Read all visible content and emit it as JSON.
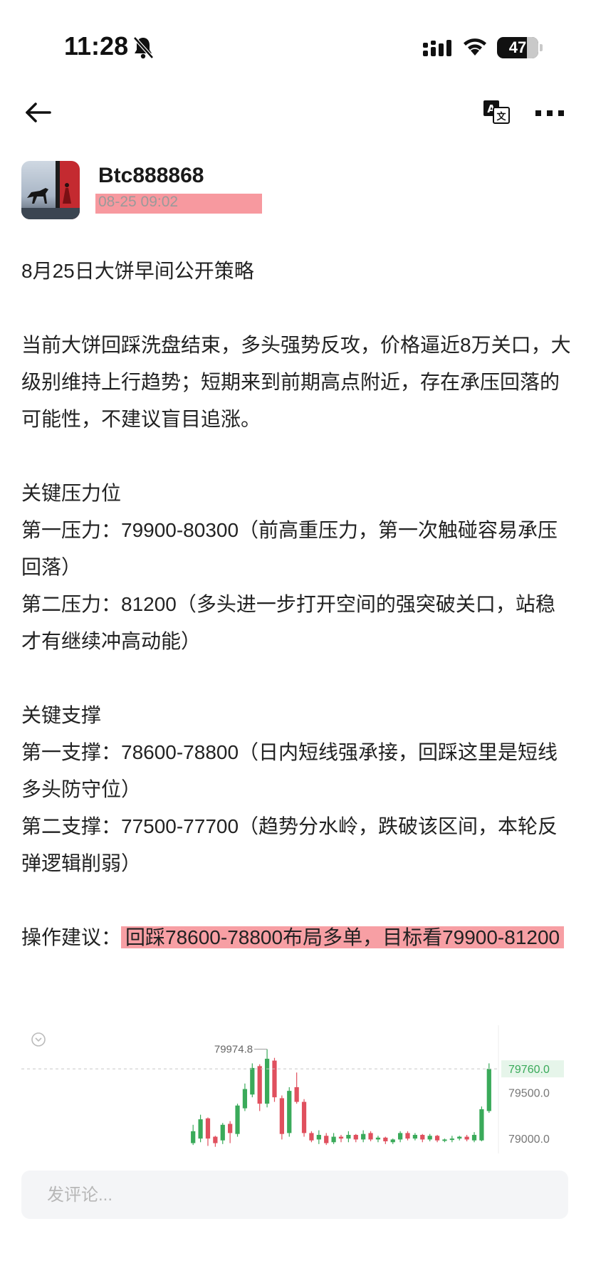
{
  "status_bar": {
    "time": "11:28",
    "battery": "47"
  },
  "post": {
    "author": "Btc888868",
    "time": "08-25 09:02",
    "title": "8月25日大饼早间公开策略",
    "intro": "当前大饼回踩洗盘结束，多头强势反攻，价格逼近8万关口，大级别维持上行趋势；短期来到前期高点附近，存在承压回落的可能性，不建议盲目追涨。",
    "resistance_heading": "关键压力位",
    "resistance_1": "第一压力：79900-80300（前高重压力，第一次触碰容易承压回落）",
    "resistance_2": "第二压力：81200（多头进一步打开空间的强突破关口，站稳才有继续冲高动能）",
    "support_heading": "关键支撑",
    "support_1": "第一支撑：78600-78800（日内短线强承接，回踩这里是短线多头防守位）",
    "support_2": "第二支撑：77500-77700（趋势分水岭，跌破该区间，本轮反弹逻辑削弱）",
    "advice_label": "操作建议：",
    "advice_text": "回踩78600-78800布局多单，目标看79900-81200"
  },
  "chart_data": {
    "type": "candlestick",
    "high_label": "79974.8",
    "price_labels": [
      "79760.0",
      "79500.0",
      "79000.0"
    ],
    "current_price": 79760.0,
    "ylim": [
      78900,
      80080
    ],
    "colors": {
      "up": "#3aaa5a",
      "down": "#e0505e",
      "current": "#3aaa5a"
    },
    "candles": [
      {
        "o": 78950,
        "c": 79080,
        "h": 79150,
        "l": 78930
      },
      {
        "o": 79000,
        "c": 79210,
        "h": 79260,
        "l": 78960
      },
      {
        "o": 79220,
        "c": 79000,
        "h": 79230,
        "l": 78920
      },
      {
        "o": 79020,
        "c": 78950,
        "h": 79030,
        "l": 78910
      },
      {
        "o": 78980,
        "c": 79150,
        "h": 79170,
        "l": 78940
      },
      {
        "o": 79160,
        "c": 79060,
        "h": 79190,
        "l": 78950
      },
      {
        "o": 79050,
        "c": 79360,
        "h": 79380,
        "l": 79020
      },
      {
        "o": 79330,
        "c": 79540,
        "h": 79600,
        "l": 79300
      },
      {
        "o": 79480,
        "c": 79770,
        "h": 79820,
        "l": 79450
      },
      {
        "o": 79790,
        "c": 79380,
        "h": 79810,
        "l": 79300
      },
      {
        "o": 79380,
        "c": 79870,
        "h": 79974,
        "l": 79340
      },
      {
        "o": 79850,
        "c": 79450,
        "h": 79880,
        "l": 79400
      },
      {
        "o": 79440,
        "c": 79050,
        "h": 79470,
        "l": 78990
      },
      {
        "o": 79060,
        "c": 79520,
        "h": 79560,
        "l": 79020
      },
      {
        "o": 79560,
        "c": 79400,
        "h": 79720,
        "l": 79380
      },
      {
        "o": 79400,
        "c": 79060,
        "h": 79430,
        "l": 79020
      },
      {
        "o": 79060,
        "c": 78980,
        "h": 79080,
        "l": 78960
      },
      {
        "o": 78990,
        "c": 79040,
        "h": 79090,
        "l": 78940
      },
      {
        "o": 79030,
        "c": 78950,
        "h": 79060,
        "l": 78930
      },
      {
        "o": 78960,
        "c": 79020,
        "h": 79060,
        "l": 78940
      },
      {
        "o": 79020,
        "c": 79000,
        "h": 79040,
        "l": 78960
      },
      {
        "o": 79000,
        "c": 79040,
        "h": 79080,
        "l": 78960
      },
      {
        "o": 79040,
        "c": 78990,
        "h": 79050,
        "l": 78960
      },
      {
        "o": 78990,
        "c": 79050,
        "h": 79090,
        "l": 78960
      },
      {
        "o": 79060,
        "c": 78990,
        "h": 79080,
        "l": 78970
      },
      {
        "o": 78990,
        "c": 79010,
        "h": 79030,
        "l": 78960
      },
      {
        "o": 79010,
        "c": 78970,
        "h": 79020,
        "l": 78940
      },
      {
        "o": 78960,
        "c": 78990,
        "h": 79000,
        "l": 78940
      },
      {
        "o": 78990,
        "c": 79060,
        "h": 79080,
        "l": 78960
      },
      {
        "o": 79060,
        "c": 79000,
        "h": 79080,
        "l": 78980
      },
      {
        "o": 79000,
        "c": 79040,
        "h": 79060,
        "l": 78980
      },
      {
        "o": 79040,
        "c": 78990,
        "h": 79050,
        "l": 78960
      },
      {
        "o": 78990,
        "c": 79030,
        "h": 79050,
        "l": 78970
      },
      {
        "o": 79030,
        "c": 78980,
        "h": 79040,
        "l": 78960
      },
      {
        "o": 78980,
        "c": 78990,
        "h": 79000,
        "l": 78960
      },
      {
        "o": 78990,
        "c": 79000,
        "h": 79030,
        "l": 78960
      },
      {
        "o": 79000,
        "c": 79020,
        "h": 79030,
        "l": 78980
      },
      {
        "o": 79020,
        "c": 78990,
        "h": 79040,
        "l": 78970
      },
      {
        "o": 78980,
        "c": 79040,
        "h": 79070,
        "l": 78960
      },
      {
        "o": 78980,
        "c": 79320,
        "h": 79350,
        "l": 78970
      },
      {
        "o": 79300,
        "c": 79760,
        "h": 79820,
        "l": 79280
      }
    ]
  },
  "comment": {
    "placeholder": "发评论..."
  }
}
